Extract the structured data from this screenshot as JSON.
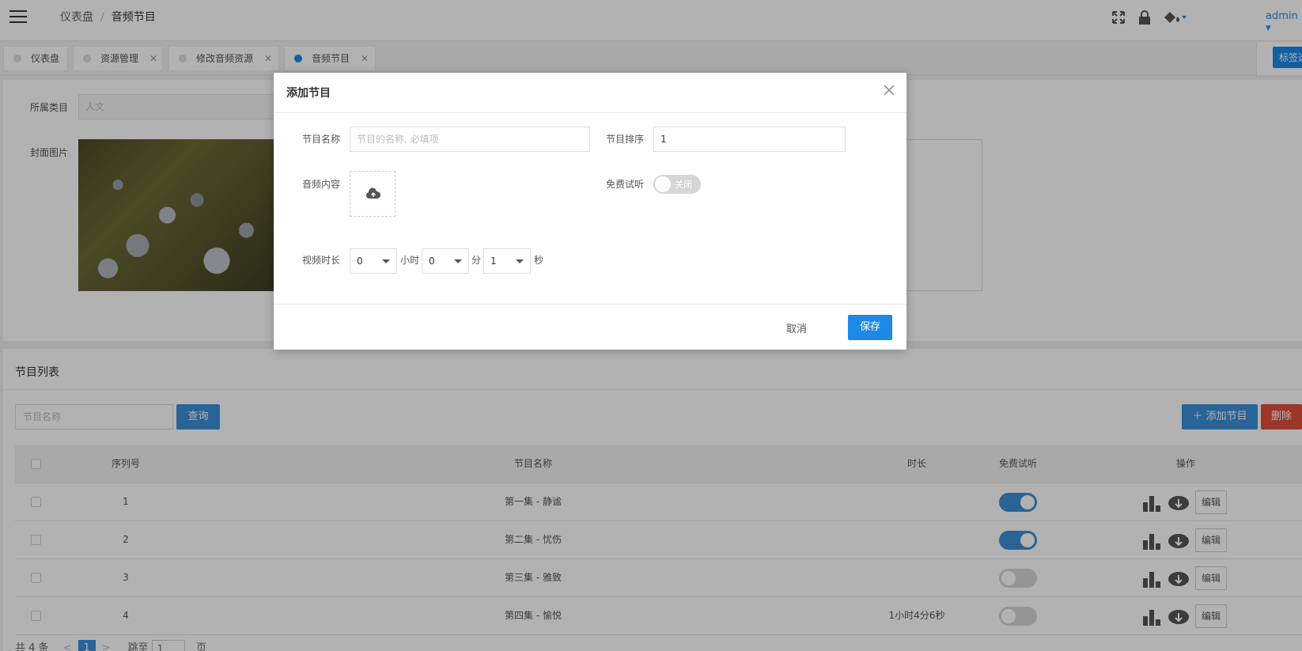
{
  "header": {
    "breadcrumb_root": "仪表盘",
    "breadcrumb_current": "音频节目",
    "user": "admin"
  },
  "tabs": [
    {
      "label": "仪表盘"
    },
    {
      "label": "资源管理"
    },
    {
      "label": "修改音频资源"
    },
    {
      "label": "音频节目"
    }
  ],
  "tab_options_label": "标签选",
  "form": {
    "category_label": "所属类目",
    "category_value": "人文",
    "cover_label": "封面图片"
  },
  "list": {
    "title": "节目列表",
    "search_placeholder": "节目名称",
    "query_label": "查询",
    "add_label": "添加节目",
    "delete_label": "删除",
    "columns": {
      "seq": "序列号",
      "name": "节目名称",
      "duration": "时长",
      "trial": "免费试听",
      "ops": "操作"
    },
    "rows": [
      {
        "seq": "1",
        "name": "第一集 - 静谧",
        "duration": "",
        "trial": true,
        "edit": "编辑"
      },
      {
        "seq": "2",
        "name": "第二集 - 忧伤",
        "duration": "",
        "trial": true,
        "edit": "编辑"
      },
      {
        "seq": "3",
        "name": "第三集 - 雅致",
        "duration": "",
        "trial": false,
        "edit": "编辑"
      },
      {
        "seq": "4",
        "name": "第四集 - 愉悦",
        "duration": "1小时4分6秒",
        "trial": false,
        "edit": "编辑"
      }
    ],
    "pagination": {
      "total": "共 4 条",
      "prev": "<",
      "page": "1",
      "next": ">",
      "jump_label": "跳至",
      "jump_value": "1",
      "page_suffix": "页"
    }
  },
  "modal": {
    "title": "添加节目",
    "name_label": "节目名称",
    "name_placeholder": "节目的名称, 必填项",
    "order_label": "节目排序",
    "order_value": "1",
    "audio_label": "音频内容",
    "trial_label": "免费试听",
    "trial_state": "关闭",
    "duration_label": "视频时长",
    "hours_value": "0",
    "hours_unit": "小时",
    "minutes_value": "0",
    "minutes_unit": "分",
    "seconds_value": "1",
    "seconds_unit": "秒",
    "cancel_label": "取消",
    "save_label": "保存"
  },
  "colors": {
    "accent": "#1e88e5",
    "danger": "#e04e3a"
  }
}
